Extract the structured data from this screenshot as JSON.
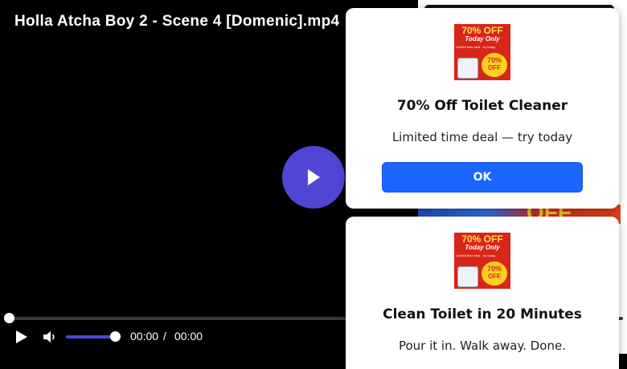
{
  "video": {
    "title": "Holla Atcha Boy 2 - Scene 4 [Domenic].mp4",
    "play_icon": "play-icon",
    "progress": 0,
    "volume": 1,
    "current_time": "00:00",
    "separator": "/",
    "duration": "00:00"
  },
  "background_ad": {
    "strip_text": "OFF"
  },
  "ad_image": {
    "line1": "70% OFF",
    "line2": "Today Only",
    "line3": "Limited time deal - try today",
    "burst1": "70%",
    "burst2": "OFF"
  },
  "popups": [
    {
      "title": "70% Off Toilet Cleaner",
      "text": "Limited time deal — try today",
      "button": "OK"
    },
    {
      "title": "Clean Toilet in 20 Minutes",
      "text": "Pour it in. Walk away. Done."
    }
  ],
  "colors": {
    "accent": "#4f46d6",
    "button": "#1a66ff",
    "background": "#000000"
  }
}
